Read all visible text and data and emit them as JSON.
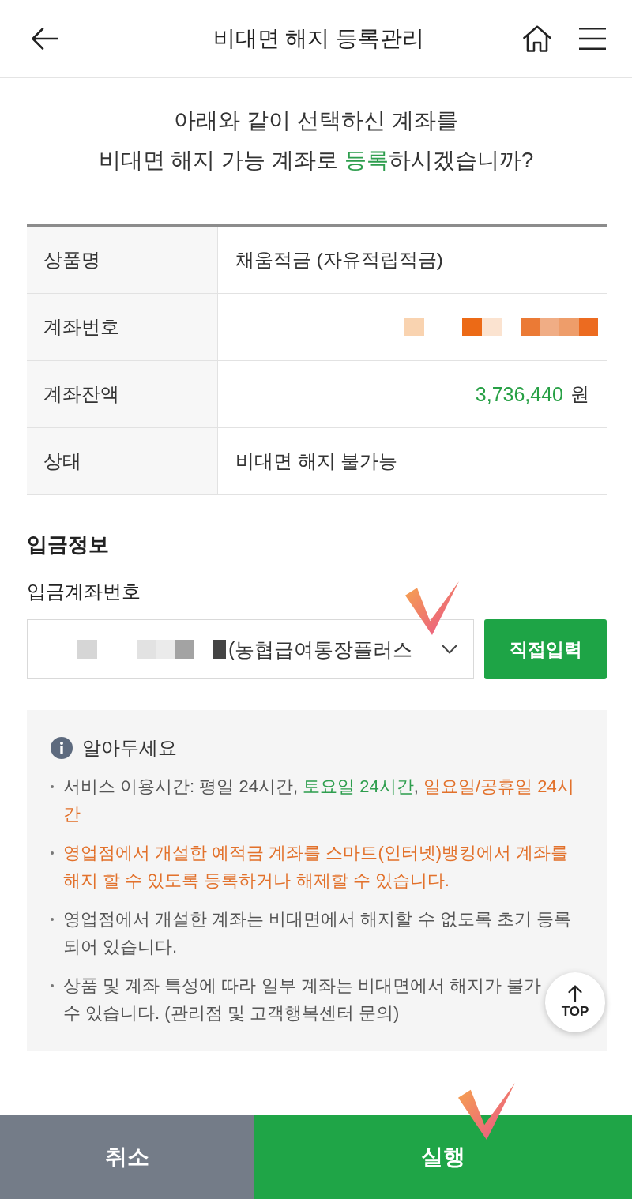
{
  "header": {
    "title": "비대면 해지 등록관리"
  },
  "question": {
    "segments": [
      {
        "text": "아래와 같이 선택하신 계좌를\n비대면 해지 가능 계좌로 ",
        "color": "#333333"
      },
      {
        "text": "등록",
        "color": "#2e9e4e"
      },
      {
        "text": "하시겠습니까?",
        "color": "#333333"
      }
    ]
  },
  "account_table": {
    "rows": [
      {
        "label": "상품명",
        "kind": "text",
        "value": "채움적금 (자유적립적금)"
      },
      {
        "label": "계좌번호",
        "kind": "masked"
      },
      {
        "label": "계좌잔액",
        "kind": "amount",
        "value": "3,736,440",
        "unit": "원"
      },
      {
        "label": "상태",
        "kind": "text",
        "value": "비대면 해지 불가능"
      }
    ]
  },
  "deposit": {
    "section_title": "입금정보",
    "field_label": "입금계좌번호",
    "select": {
      "value": "(농협급여통장플러스"
    },
    "button": "직접입력"
  },
  "notice": {
    "title": "알아두세요",
    "items": [
      {
        "segments": [
          {
            "text": "서비스 이용시간: 평일 24시간, ",
            "color": "#555555"
          },
          {
            "text": "토요일 24시간",
            "color": "#2e9e4e"
          },
          {
            "text": ", ",
            "color": "#555555"
          },
          {
            "text": "일요일/공휴일 24시간",
            "color": "#e2712b"
          }
        ]
      },
      {
        "segments": [
          {
            "text": "영업점에서 개설한 예적금 계좌를 스마트(인터넷)뱅킹에서 계좌를 해지 할 수 있도록 등록하거나 해제할 수 있습니다.",
            "color": "#e2712b"
          }
        ]
      },
      {
        "segments": [
          {
            "text": "영업점에서 개설한 계좌는 비대면에서 해지할 수 없도록 초기 등록 되어 있습니다.",
            "color": "#555555"
          }
        ]
      },
      {
        "segments": [
          {
            "text": "상품 및 계좌 특성에 따라 일부 계좌는 비대면에서 해지가 불가\n수 있습니다. (관리점 및 고객행복센터 문의)",
            "color": "#555555"
          }
        ]
      }
    ]
  },
  "top_button": {
    "label": "TOP"
  },
  "actions": [
    {
      "label": "취소",
      "kind": "cancel"
    },
    {
      "label": "실행",
      "kind": "primary"
    }
  ]
}
